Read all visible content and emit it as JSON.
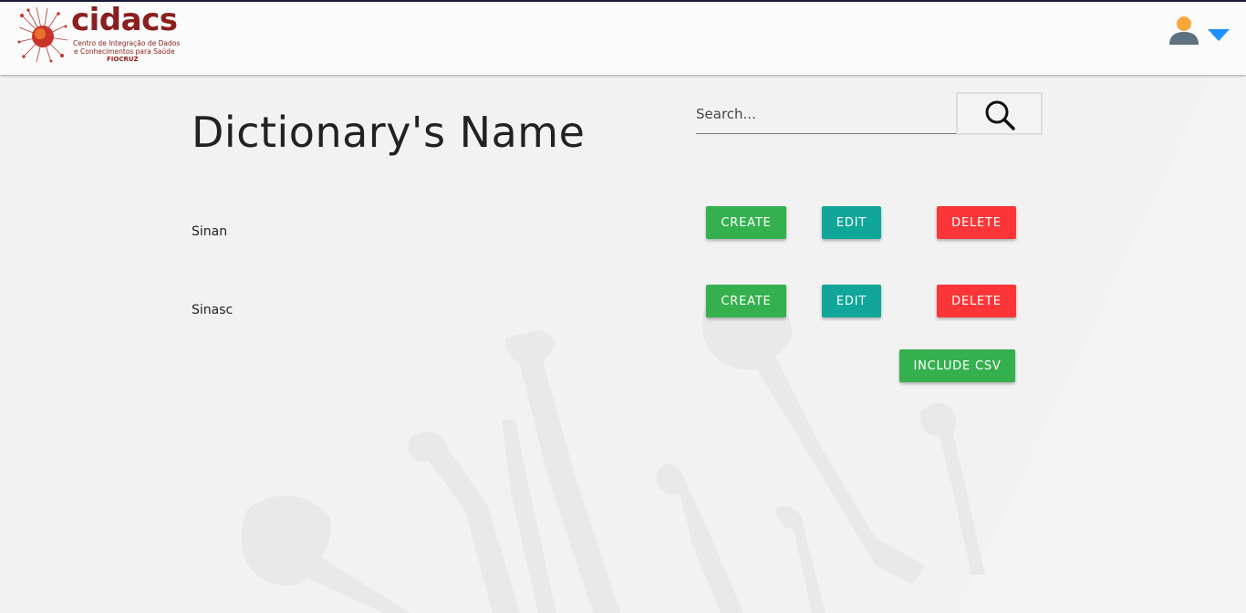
{
  "header": {
    "logo": {
      "word": "cidacs",
      "line1": "Centro de Integração de Dados",
      "line2": "e Conhecimentos para Saúde",
      "line3": "FIOCRUZ"
    },
    "user_menu": {
      "avatar_icon": "user-avatar-icon",
      "caret_icon": "caret-down-icon",
      "caret_color": "#1e90ff"
    }
  },
  "main": {
    "title": "Dictionary's Name",
    "search": {
      "placeholder": "Search...",
      "value": "",
      "icon": "search-icon"
    },
    "rows": [
      {
        "label": "Sinan",
        "create": "CREATE",
        "edit": "EDIT",
        "delete": "DELETE"
      },
      {
        "label": "Sinasc",
        "create": "CREATE",
        "edit": "EDIT",
        "delete": "DELETE"
      }
    ],
    "include_csv": "INCLUDE CSV"
  },
  "colors": {
    "create": "#35b04f",
    "edit": "#10a69a",
    "delete": "#fc3538",
    "brand": "#8b1e1e"
  }
}
